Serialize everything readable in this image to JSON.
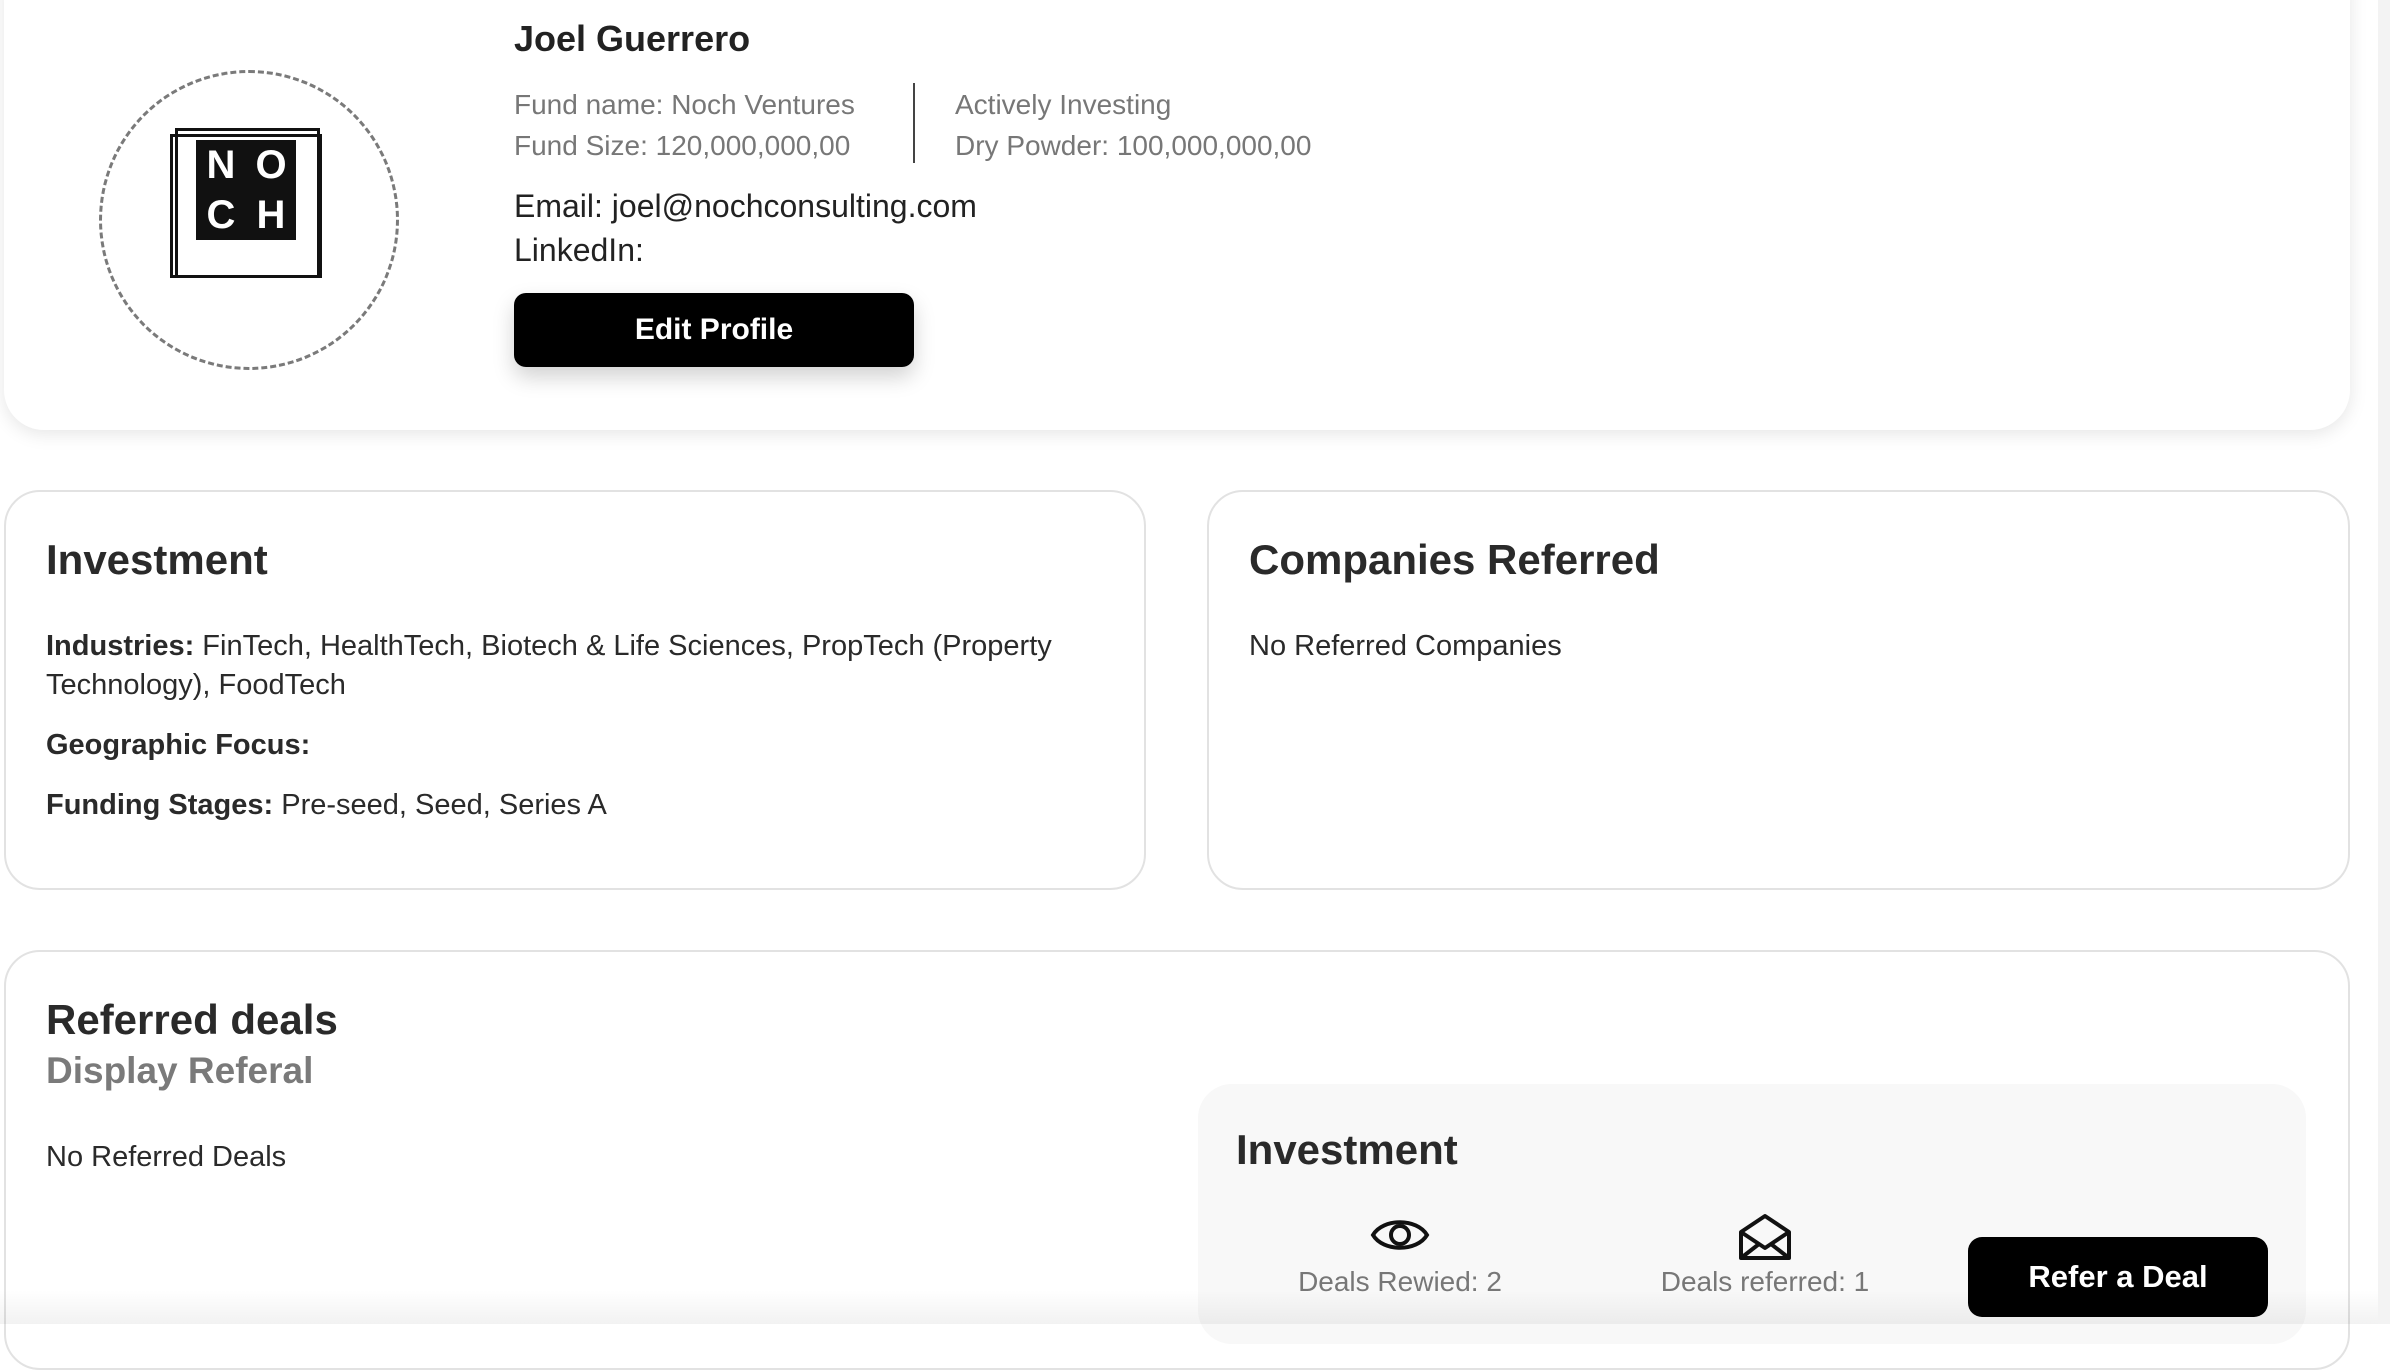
{
  "profile": {
    "name": "Joel Guerrero",
    "logo_letters": [
      "N",
      "O",
      "C",
      "H"
    ],
    "fund_name": "Fund name: Noch Ventures",
    "fund_size": "Fund Size: 120,000,000,00",
    "status": "Actively Investing",
    "dry_powder": "Dry Powder: 100,000,000,00",
    "email": "Email: joel@nochconsulting.com",
    "linkedin": "LinkedIn:",
    "edit_label": "Edit Profile"
  },
  "investment": {
    "title": "Investment",
    "industries_label": "Industries:",
    "industries_value": " FinTech, HealthTech, Biotech & Life Sciences, PropTech (Property Technology), FoodTech",
    "geo_label": "Geographic Focus:",
    "geo_value": "",
    "stages_label": "Funding Stages:",
    "stages_value": " Pre-seed, Seed, Series A"
  },
  "companies": {
    "title": "Companies Referred",
    "empty": "No Referred Companies"
  },
  "deals": {
    "title": "Referred deals",
    "subtitle": "Display Referal",
    "empty": "No Referred Deals",
    "panel_title": "Investment",
    "reviewed": "Deals Rewied: 2",
    "referred": "Deals referred: 1",
    "refer_label": "Refer a Deal"
  },
  "icons": {
    "reviewed": "eye-icon",
    "referred": "envelope-open-icon"
  }
}
